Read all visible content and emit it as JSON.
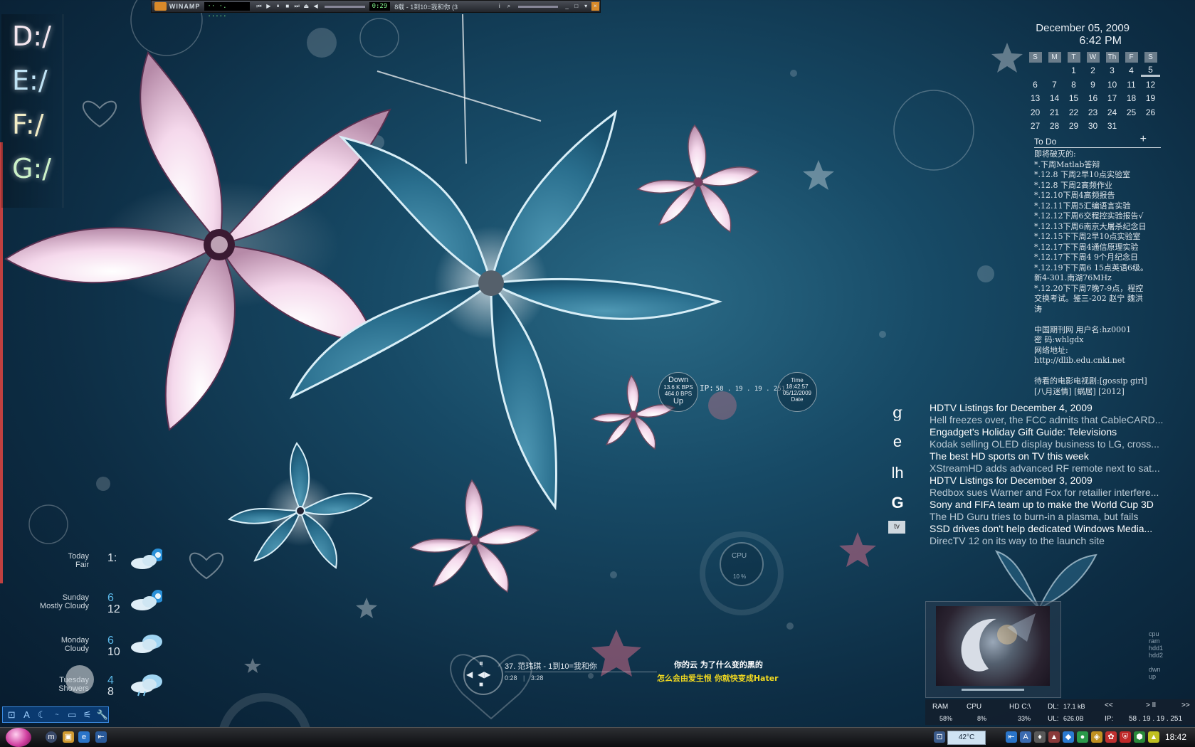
{
  "winamp": {
    "brand": "WINAMP",
    "display": "·· ·. .....",
    "time": "0:29",
    "track": "8载 - 1到10=我和你 (3"
  },
  "drives": [
    "D:/",
    "E:/",
    "F:/",
    "G:/"
  ],
  "calendar": {
    "date": "December 05, 2009",
    "time": "6:42 PM",
    "weekdays": [
      "S",
      "M",
      "T",
      "W",
      "Th",
      "F",
      "S"
    ],
    "weeks": [
      [
        "",
        "",
        "1",
        "2",
        "3",
        "4",
        "5"
      ],
      [
        "6",
        "7",
        "8",
        "9",
        "10",
        "11",
        "12"
      ],
      [
        "13",
        "14",
        "15",
        "16",
        "17",
        "18",
        "19"
      ],
      [
        "20",
        "21",
        "22",
        "23",
        "24",
        "25",
        "26"
      ],
      [
        "27",
        "28",
        "29",
        "30",
        "31",
        "",
        ""
      ]
    ],
    "today": "5"
  },
  "todo": {
    "title": "To Do",
    "add": "+",
    "lines": [
      "即将破灭的:",
      "*.下周Matlab答辩",
      "*.12.8 下周2早10点实验室",
      "*.12.8 下周2高频作业",
      "*.12.10下周4高频报告",
      "*.12.11下周5汇编语言实验",
      "*.12.12下周6交程控实验报告√",
      "*.12.13下周6南京大屠杀纪念日",
      "*.12.15下下周2早10点实验室",
      "*.12.17下下周4通信原理实验",
      "*.12.17下下周4 9个月纪念日",
      "*.12.19下下周6 15点英语6级。",
      "新4-301.南湖76MHz",
      "*.12.20下下周7晚7-9点，程控",
      "交换考试。鉴三-202 赵宁 魏洪",
      "涛",
      "",
      "中国期刊网 用户名:hz0001",
      "密 码:whlgdx",
      "网络地址:",
      "http://dlib.edu.cnki.net",
      "",
      "待看的电影电视剧:[gossip girl]",
      "[八月迷情] [蜗居] [2012]"
    ]
  },
  "net": {
    "down_label": "Down",
    "down_rate": "13.6 K BPS",
    "up_rate": "464.0 BPS",
    "up_label": "Up",
    "ip_label": "IP:",
    "ip": "58 . 19 . 19 . 251",
    "time_label": "Time",
    "time": "18:42:57",
    "date": "05/12/2009",
    "date_label": "Date"
  },
  "rss": [
    {
      "h": "HDTV Listings for December 4, 2009",
      "s": "Hell freezes over, the FCC admits that CableCARD..."
    },
    {
      "h": "Engadget's Holiday Gift Guide: Televisions",
      "s": "Kodak selling OLED display business to LG, cross..."
    },
    {
      "h": "The best HD sports on TV this week",
      "s": "XStreamHD adds advanced RF remote next to sat..."
    },
    {
      "h": "HDTV Listings for December 3, 2009",
      "s": "Redbox sues Warner and Fox for retailier interfere..."
    },
    {
      "h": "Sony and FIFA team up to make the World Cup 3D",
      "s": "The HD Guru tries to burn-in a plasma, but fails"
    },
    {
      "h": "SSD drives don't help dedicated Windows Media...",
      "s": "DirecTV 12 on its way to the launch site"
    }
  ],
  "rss_icons": [
    "g",
    "e",
    "lh",
    "G",
    "tv"
  ],
  "weather": [
    {
      "day": "Today",
      "cond": "Fair",
      "hi": "",
      "lo": "1:",
      "icon": "partly-cloudy-gear-icon"
    },
    {
      "day": "Sunday",
      "cond": "Mostly Cloudy",
      "hi": "6",
      "lo": "12",
      "icon": "partly-cloudy-gear-icon"
    },
    {
      "day": "Monday",
      "cond": "Cloudy",
      "hi": "6",
      "lo": "10",
      "icon": "cloudy-icon"
    },
    {
      "day": "Tuesday",
      "cond": "Showers",
      "hi": "4",
      "lo": "8",
      "icon": "showers-icon"
    }
  ],
  "cpu_gauge": {
    "label": "CPU",
    "value": "10 %"
  },
  "player": {
    "track": "37. 范玮琪 - 1到10=我和你",
    "elapsed": "0:28",
    "total": "3:28"
  },
  "lyrics": {
    "line1": "你的云  为了什么变的黑的",
    "line2": "怎么会由爱生恨  你就快变成Hater"
  },
  "sysbar": {
    "ram_label": "RAM",
    "ram": "58%",
    "cpu_label": "CPU",
    "cpu": "8%",
    "hd_label": "HD C:\\",
    "hd": "33%",
    "dl_label": "DL:",
    "dl": "17.1 kB",
    "ul_label": "UL:",
    "ul": "626.0B",
    "ip_label": "IP:",
    "ip": "58 . 19 . 19 . 251",
    "prev": "<<",
    "play": "> II",
    ">>": ">>"
  },
  "small_stats": [
    "cpu",
    "ram",
    "hdd1",
    "hdd2",
    "",
    "dwn",
    "up"
  ],
  "taskbar": {
    "temp": "42°C",
    "clock": "18:42"
  }
}
